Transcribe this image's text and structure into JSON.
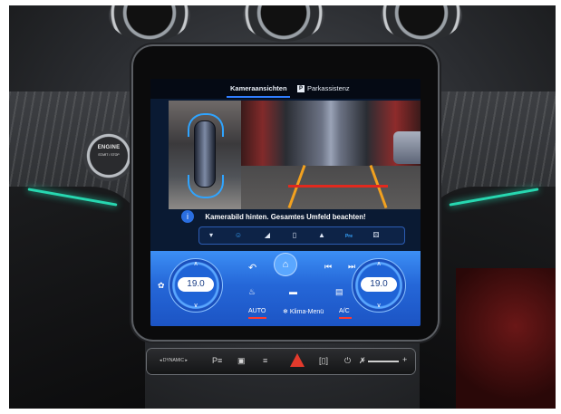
{
  "engine_button": {
    "line1": "ENGINE",
    "line2": "START / STOP"
  },
  "screen": {
    "tabs": [
      {
        "label": "Kameraansichten",
        "active": true
      },
      {
        "label": "Parkassistenz",
        "active": false,
        "badge": "P"
      }
    ],
    "warning_text": "Kamerabild hinten. Gesamtes Umfeld beachten!",
    "info_icon": "i",
    "camera_strip": {
      "buttons": [
        {
          "icon": "sensor-icon",
          "glyph": "▾"
        },
        {
          "icon": "person-icon",
          "glyph": "☺"
        },
        {
          "icon": "rear-angle-icon",
          "glyph": "◢"
        },
        {
          "icon": "topview-icon",
          "glyph": "▯"
        },
        {
          "icon": "car-side-icon",
          "glyph": "▲"
        },
        {
          "icon": "pre-icon",
          "label": "Pre",
          "active": true
        },
        {
          "icon": "trailer-icon",
          "glyph": "⚄"
        }
      ]
    },
    "climate": {
      "left_temp": "19.0",
      "right_temp": "19.0",
      "left_label": "AUTO",
      "center_label": "Klima-Menü",
      "right_label": "A/C",
      "back_glyph": "↶",
      "home_glyph": "⌂",
      "prev_glyph": "⏮",
      "next_glyph": "⏭",
      "chevron_up": "∧",
      "chevron_down": "∨",
      "fan_glyph": "✿",
      "seat_heat_glyph": "♨",
      "car_glyph": "▬",
      "defrost_glyph": "▤",
      "climate_menu_glyph": "❄"
    }
  },
  "button_bar": {
    "dynamic_label": "◂ DYNAMIC ▸",
    "icons": [
      "parking-icon",
      "camera-icon",
      "seat-icon",
      "hazard-icon",
      "mirror-icon",
      "power-icon",
      "mute-icon",
      "volume-icon"
    ],
    "glyphs": {
      "parking": "P≡",
      "camera": "▣",
      "seat": "≡",
      "mirror": "[▯]",
      "power": "⏻",
      "mute": "✗",
      "minus": "-",
      "plus": "+"
    }
  },
  "colors": {
    "accent_blue": "#2f7dff",
    "climate_blue": "#2567d8",
    "ambient_teal": "#27d7b0",
    "hazard_red": "#e33a2c",
    "underline_red": "#ff3b30",
    "lane_orange": "#f2a11f"
  }
}
